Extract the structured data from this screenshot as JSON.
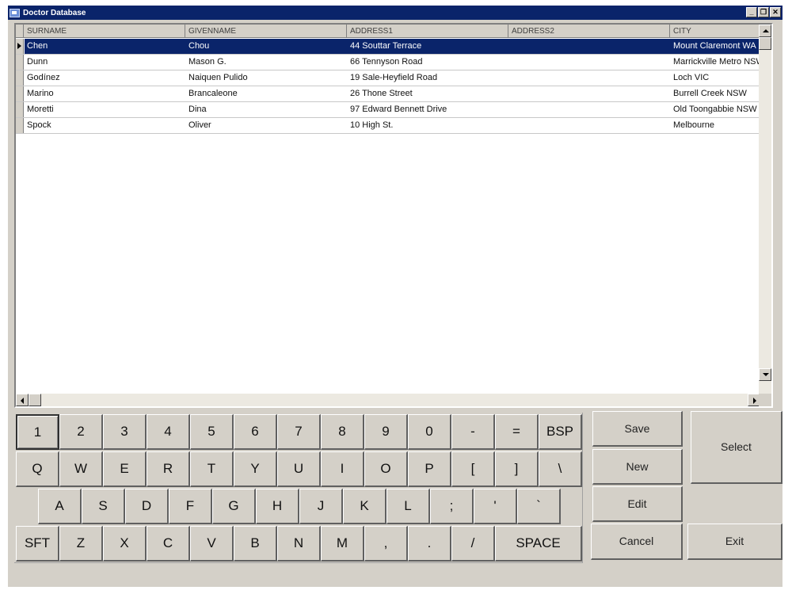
{
  "window": {
    "title": "Doctor Database",
    "controls": {
      "minimize": "_",
      "restore": "❐",
      "close": "✕"
    }
  },
  "grid": {
    "columns": [
      "SURNAME",
      "GIVENNAME",
      "ADDRESS1",
      "ADDRESS2",
      "CITY"
    ],
    "selected_row": 0,
    "rows": [
      {
        "surname": "Chen",
        "givenname": "Chou",
        "address1": "44 Souttar Terrace",
        "address2": "",
        "city": "Mount Claremont WA"
      },
      {
        "surname": "Dunn",
        "givenname": "Mason G.",
        "address1": "66 Tennyson Road",
        "address2": "",
        "city": "Marrickville Metro NSW"
      },
      {
        "surname": "Godínez",
        "givenname": "Naiquen Pulido",
        "address1": "19 Sale-Heyfield Road",
        "address2": "",
        "city": "Loch VIC"
      },
      {
        "surname": "Marino",
        "givenname": "Brancaleone",
        "address1": "26 Thone Street",
        "address2": "",
        "city": "Burrell Creek NSW"
      },
      {
        "surname": "Moretti",
        "givenname": "Dina",
        "address1": "97 Edward Bennett Drive",
        "address2": "",
        "city": "Old Toongabbie NSW"
      },
      {
        "surname": "Spock",
        "givenname": "Oliver",
        "address1": "10 High St.",
        "address2": "",
        "city": "Melbourne"
      }
    ]
  },
  "keyboard": {
    "row1": [
      "1",
      "2",
      "3",
      "4",
      "5",
      "6",
      "7",
      "8",
      "9",
      "0",
      "-",
      "=",
      "BSP"
    ],
    "row2": [
      "Q",
      "W",
      "E",
      "R",
      "T",
      "Y",
      "U",
      "I",
      "O",
      "P",
      "[",
      "]",
      "\\"
    ],
    "row3": [
      "A",
      "S",
      "D",
      "F",
      "G",
      "H",
      "J",
      "K",
      "L",
      ";",
      "'",
      "`"
    ],
    "row4": [
      "SFT",
      "Z",
      "X",
      "C",
      "V",
      "B",
      "N",
      "M",
      ",",
      ".",
      "/",
      "SPACE"
    ],
    "focused_key": "1"
  },
  "actions": {
    "save": "Save",
    "new": "New",
    "edit": "Edit",
    "cancel": "Cancel",
    "select": "Select",
    "exit": "Exit"
  },
  "colors": {
    "titlebar": "#0a246a",
    "selection": "#0a246a",
    "face": "#d4d0c8"
  }
}
